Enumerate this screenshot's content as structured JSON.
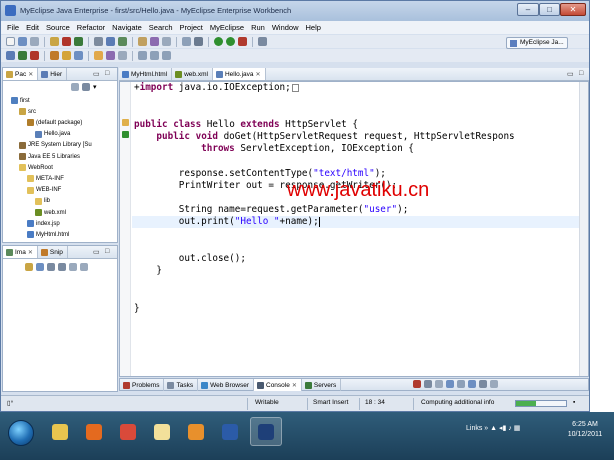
{
  "window": {
    "title": "MyEclipse Java Enterprise - first/src/Hello.java - MyEclipse Enterprise Workbench",
    "controls": {
      "minimize": "–",
      "maximize": "□",
      "close": "✕"
    }
  },
  "menu": [
    "File",
    "Edit",
    "Source",
    "Refactor",
    "Navigate",
    "Search",
    "Project",
    "MyEclipse",
    "Run",
    "Window",
    "Help"
  ],
  "perspective": "MyEclipse Ja...",
  "left_top_panel": {
    "tabs": [
      {
        "label": "Pac",
        "icon": "package-explorer-icon"
      },
      {
        "label": "Hier",
        "icon": "hierarchy-icon"
      }
    ],
    "tree": [
      {
        "label": "first",
        "icon": "project-icon",
        "color": "#4f7fbf"
      },
      {
        "label": "src",
        "icon": "source-folder-icon",
        "color": "#c9a544"
      },
      {
        "label": "(default package)",
        "icon": "package-icon",
        "color": "#b07d2a"
      },
      {
        "label": "Hello.java",
        "icon": "java-file-icon",
        "color": "#5a7fb8"
      },
      {
        "label": "JRE System Library [Su",
        "icon": "library-icon",
        "color": "#8a6b3a"
      },
      {
        "label": "Java EE 5 Libraries",
        "icon": "library-icon",
        "color": "#8a6b3a"
      },
      {
        "label": "WebRoot",
        "icon": "folder-icon",
        "color": "#e2c15a"
      },
      {
        "label": "META-INF",
        "icon": "folder-icon",
        "color": "#e2c15a"
      },
      {
        "label": "WEB-INF",
        "icon": "folder-icon",
        "color": "#e2c15a"
      },
      {
        "label": "lib",
        "icon": "folder-icon",
        "color": "#e2c15a"
      },
      {
        "label": "web.xml",
        "icon": "xml-file-icon",
        "color": "#6b8e23"
      },
      {
        "label": "index.jsp",
        "icon": "jsp-file-icon",
        "color": "#4a7cc4"
      },
      {
        "label": "MyHtml.html",
        "icon": "html-file-icon",
        "color": "#4a7cc4"
      }
    ]
  },
  "left_bottom_panel": {
    "tabs": [
      {
        "label": "Ima",
        "icon": "image-preview-icon"
      },
      {
        "label": "Snip",
        "icon": "snippets-icon"
      }
    ]
  },
  "editor": {
    "tabs": [
      {
        "label": "MyHtml.html",
        "icon": "html-file-icon",
        "active": false
      },
      {
        "label": "web.xml",
        "icon": "xml-file-icon",
        "active": false
      },
      {
        "label": "Hello.java",
        "icon": "java-file-icon",
        "active": true
      }
    ],
    "lines": [
      [
        {
          "t": "+",
          "c": "plain"
        },
        {
          "t": "import",
          "c": "kw"
        },
        {
          "t": " java.io.IOException;",
          "c": "plain"
        }
      ],
      [],
      [],
      [
        {
          "t": "public",
          "c": "kw"
        },
        {
          "t": " ",
          "c": "plain"
        },
        {
          "t": "class",
          "c": "kw"
        },
        {
          "t": " Hello ",
          "c": "plain"
        },
        {
          "t": "extends",
          "c": "kw"
        },
        {
          "t": " HttpServlet {",
          "c": "plain"
        }
      ],
      [
        {
          "t": "    ",
          "c": "plain"
        },
        {
          "t": "public",
          "c": "kw"
        },
        {
          "t": " ",
          "c": "plain"
        },
        {
          "t": "void",
          "c": "kw"
        },
        {
          "t": " doGet(HttpServletRequest request, HttpServletRespons",
          "c": "plain"
        }
      ],
      [
        {
          "t": "            ",
          "c": "plain"
        },
        {
          "t": "throws",
          "c": "kw"
        },
        {
          "t": " ServletException, IOException {",
          "c": "plain"
        }
      ],
      [],
      [
        {
          "t": "        response.setContentType(",
          "c": "plain"
        },
        {
          "t": "\"text/html\"",
          "c": "str"
        },
        {
          "t": ");",
          "c": "plain"
        }
      ],
      [
        {
          "t": "        PrintWriter out = response.getWriter();",
          "c": "plain"
        }
      ],
      [],
      [
        {
          "t": "        String name=request.getParameter(",
          "c": "plain"
        },
        {
          "t": "\"user\"",
          "c": "str"
        },
        {
          "t": ");",
          "c": "plain"
        }
      ],
      [
        {
          "t": "        out.print(",
          "c": "plain"
        },
        {
          "t": "\"Hello \"",
          "c": "str"
        },
        {
          "t": "+name);",
          "c": "plain"
        }
      ],
      [],
      [],
      [
        {
          "t": "        out.close();",
          "c": "plain"
        }
      ],
      [
        {
          "t": "    }",
          "c": "plain"
        }
      ],
      [],
      [],
      [
        {
          "t": "}",
          "c": "plain"
        }
      ]
    ]
  },
  "watermark": "www.javatiku.cn",
  "bottom_panel": {
    "tabs": [
      {
        "label": "Problems",
        "icon": "problems-icon",
        "active": false
      },
      {
        "label": "Tasks",
        "icon": "tasks-icon",
        "active": false
      },
      {
        "label": "Web Browser",
        "icon": "globe-icon",
        "active": false
      },
      {
        "label": "Console",
        "icon": "console-icon",
        "active": true
      },
      {
        "label": "Servers",
        "icon": "servers-icon",
        "active": false
      }
    ]
  },
  "status": {
    "mode": "Writable",
    "insert": "Smart Insert",
    "position": "18 : 34",
    "task": "Computing additional info",
    "progress": 0.4
  },
  "taskbar": {
    "apps": [
      {
        "name": "explorer-icon",
        "color": "#e8c54f",
        "active": false
      },
      {
        "name": "firefox-icon",
        "color": "#e46a1f",
        "active": false
      },
      {
        "name": "chrome-icon",
        "color": "#d94a3a",
        "active": false
      },
      {
        "name": "notepad-icon",
        "color": "#f2e09a",
        "active": false
      },
      {
        "name": "media-player-icon",
        "color": "#e8902c",
        "active": false
      },
      {
        "name": "word-icon",
        "color": "#2b5ba8",
        "active": false
      },
      {
        "name": "myeclipse-icon",
        "color": "#1e3f78",
        "active": true
      }
    ],
    "tray_label": "Links",
    "time": "6:25 AM",
    "date": "10/12/2011"
  }
}
